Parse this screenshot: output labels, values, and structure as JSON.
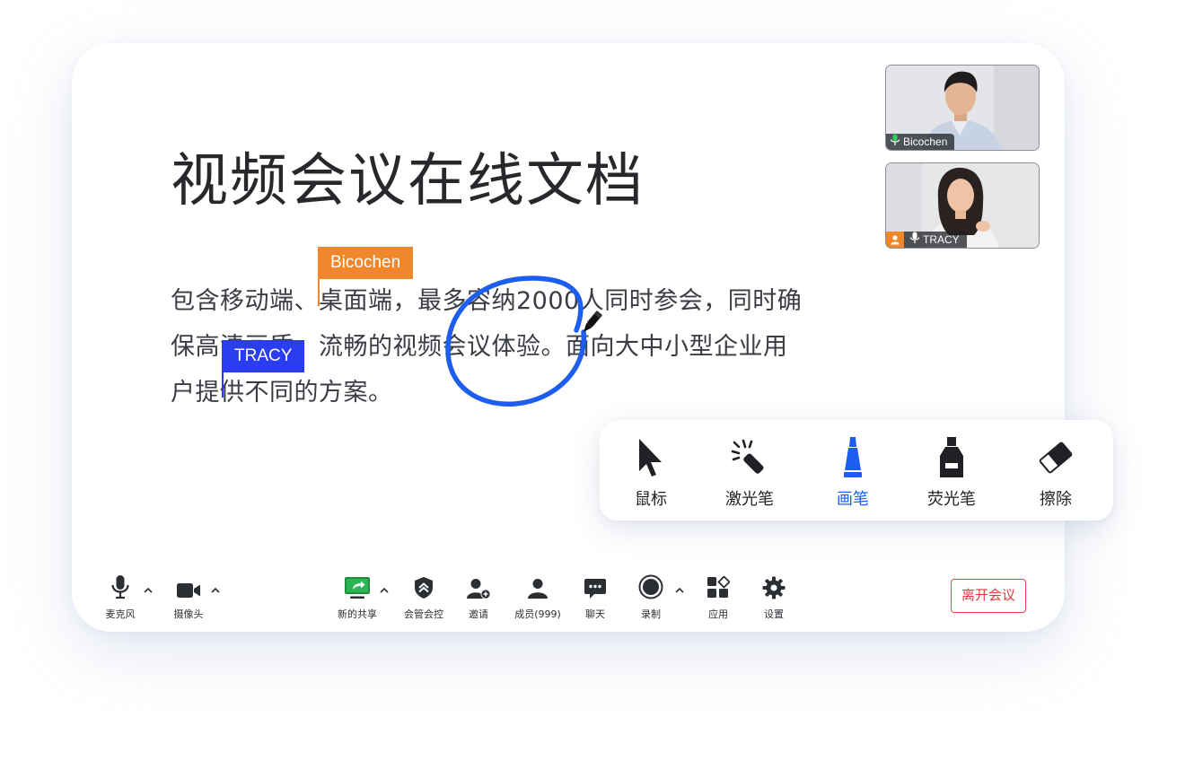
{
  "document": {
    "title": "视频会议在线文档",
    "body_lines": [
      "包含移动端、桌面端，最多容纳2000人同时参会，同时确",
      "保高清画质、流畅的视频会议体验。面向大中小型企业用",
      "户提供不同的方案。"
    ]
  },
  "collaborators": [
    {
      "name": "Bicochen",
      "color": "#f0872a"
    },
    {
      "name": "TRACY",
      "color": "#2b3df0"
    }
  ],
  "ink": {
    "color": "#1d5ef0"
  },
  "participants": [
    {
      "name": "Bicochen",
      "mic": "active",
      "host": false
    },
    {
      "name": "TRACY",
      "mic": "on",
      "host": true
    }
  ],
  "pen_tools": [
    {
      "label": "鼠标",
      "icon": "pointer-icon",
      "active": false
    },
    {
      "label": "激光笔",
      "icon": "laser-pen-icon",
      "active": false
    },
    {
      "label": "画笔",
      "icon": "brush-icon",
      "active": true
    },
    {
      "label": "荧光笔",
      "icon": "highlighter-icon",
      "active": false
    },
    {
      "label": "擦除",
      "icon": "eraser-icon",
      "active": false
    }
  ],
  "meeting_toolbar": {
    "mic": "麦克风",
    "camera": "摄像头",
    "share": "新的共享",
    "control": "会管会控",
    "invite": "邀请",
    "members": "成员(999)",
    "chat": "聊天",
    "record": "录制",
    "apps": "应用",
    "settings": "设置",
    "leave": "离开会议"
  },
  "colors": {
    "accent": "#1d5ef0",
    "share_green": "#22b14c",
    "danger": "#e0393e"
  }
}
